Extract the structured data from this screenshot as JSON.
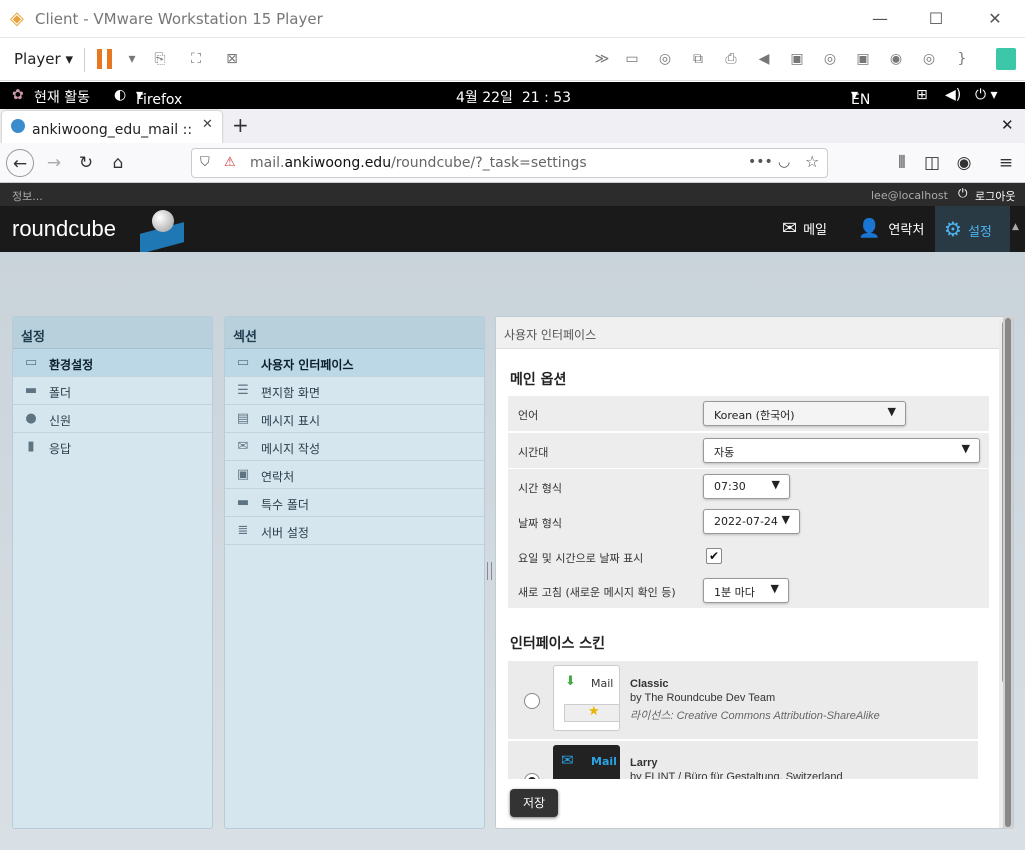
{
  "vmware": {
    "title": "Client - VMware Workstation 15 Player",
    "player_label": "Player"
  },
  "gnome": {
    "activities": "현재 활동",
    "app": "Firefox",
    "clock": "4월 22일  21 : 53",
    "lang": "EN"
  },
  "firefox": {
    "tab_title": "ankiwoong_edu_mail :: 환",
    "url_pre": "mail.",
    "url_domain": "ankiwoong.edu",
    "url_path": "/roundcube/?_task=settings"
  },
  "rc": {
    "info": "정보...",
    "user": "lee@localhost",
    "logout": "로그아웃",
    "logo": "roundcube",
    "nav": {
      "mail": "메일",
      "contacts": "연락처",
      "settings": "설정"
    },
    "settings_panel": {
      "title": "설정",
      "items": [
        {
          "label": "환경설정",
          "icon": "monitor-icon"
        },
        {
          "label": "폴더",
          "icon": "folder-icon"
        },
        {
          "label": "신원",
          "icon": "person-icon"
        },
        {
          "label": "응답",
          "icon": "document-icon"
        }
      ]
    },
    "section_panel": {
      "title": "섹션",
      "items": [
        {
          "label": "사용자 인터페이스",
          "icon": "monitor-icon"
        },
        {
          "label": "편지함 화면",
          "icon": "list-icon"
        },
        {
          "label": "메시지 표시",
          "icon": "message-icon"
        },
        {
          "label": "메시지 작성",
          "icon": "compose-icon"
        },
        {
          "label": "연락처",
          "icon": "contact-card-icon"
        },
        {
          "label": "특수 폴더",
          "icon": "folder-icon"
        },
        {
          "label": "서버 설정",
          "icon": "server-icon"
        }
      ]
    },
    "content": {
      "header": "사용자 인터페이스",
      "main_options_title": "메인 옵션",
      "options": {
        "language": {
          "label": "언어",
          "value": "Korean (한국어)"
        },
        "timezone": {
          "label": "시간대",
          "value": "자동"
        },
        "time_format": {
          "label": "시간 형식",
          "value": "07:30"
        },
        "date_format": {
          "label": "날짜 형식",
          "value": "2022-07-24"
        },
        "pretty_date": {
          "label": "요일 및 시간으로 날짜 표시",
          "checked": true
        },
        "refresh": {
          "label": "새로 고침 (새로운 메시지 확인 등)",
          "value": "1분 마다"
        }
      },
      "skin_title": "인터페이스 스킨",
      "skins": [
        {
          "name": "Classic",
          "author": "by The Roundcube Dev Team",
          "license": "라이선스: Creative Commons Attribution-ShareAlike",
          "thumb_label": "Mail",
          "selected": false
        },
        {
          "name": "Larry",
          "author": "by FLINT / Büro für Gestaltung, Switzerland",
          "thumb_label": "Mail",
          "selected": true
        }
      ],
      "save": "저장"
    }
  }
}
